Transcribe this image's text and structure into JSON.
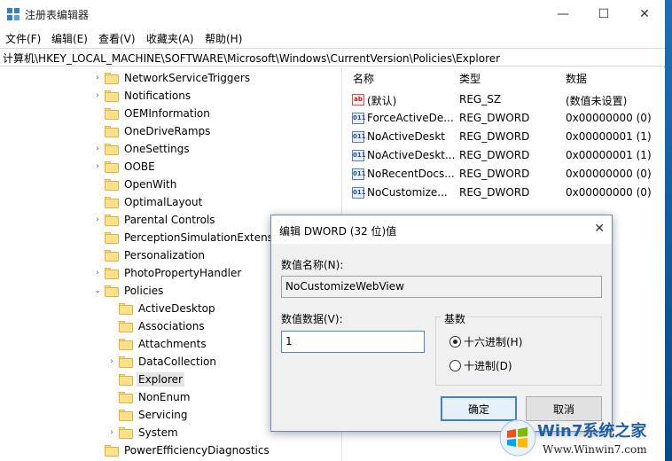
{
  "window": {
    "title": "注册表编辑器",
    "minimize": "—",
    "maximize": "☐",
    "close": "✕"
  },
  "menu": [
    "文件(F)",
    "编辑(E)",
    "查看(V)",
    "收藏夹(A)",
    "帮助(H)"
  ],
  "address": "计算机\\HKEY_LOCAL_MACHINE\\SOFTWARE\\Microsoft\\Windows\\CurrentVersion\\Policies\\Explorer",
  "tree": [
    {
      "label": "NetworkServiceTriggers",
      "arrow": "›"
    },
    {
      "label": "Notifications",
      "arrow": "›"
    },
    {
      "label": "OEMInformation",
      "arrow": ""
    },
    {
      "label": "OneDriveRamps",
      "arrow": ""
    },
    {
      "label": "OneSettings",
      "arrow": "›"
    },
    {
      "label": "OOBE",
      "arrow": "›"
    },
    {
      "label": "OpenWith",
      "arrow": ""
    },
    {
      "label": "OptimalLayout",
      "arrow": ""
    },
    {
      "label": "Parental Controls",
      "arrow": "›"
    },
    {
      "label": "PerceptionSimulationExtensio",
      "arrow": ""
    },
    {
      "label": "Personalization",
      "arrow": ""
    },
    {
      "label": "PhotoPropertyHandler",
      "arrow": "›"
    },
    {
      "label": "Policies",
      "arrow": "⌄"
    },
    {
      "label": "ActiveDesktop",
      "arrow": ""
    },
    {
      "label": "Associations",
      "arrow": ""
    },
    {
      "label": "Attachments",
      "arrow": ""
    },
    {
      "label": "DataCollection",
      "arrow": "›"
    },
    {
      "label": "Explorer",
      "arrow": ""
    },
    {
      "label": "NonEnum",
      "arrow": ""
    },
    {
      "label": "Servicing",
      "arrow": ""
    },
    {
      "label": "System",
      "arrow": "›"
    },
    {
      "label": "PowerEfficiencyDiagnostics",
      "arrow": ""
    }
  ],
  "list": {
    "headers": {
      "name": "名称",
      "type": "类型",
      "data": "数据"
    },
    "rows": [
      {
        "icon": "ab",
        "name": "(默认)",
        "type": "REG_SZ",
        "data": "(数值未设置)"
      },
      {
        "icon": "011",
        "name": "ForceActiveDe...",
        "type": "REG_DWORD",
        "data": "0x00000000 (0)"
      },
      {
        "icon": "011",
        "name": "NoActiveDeskt",
        "type": "REG_DWORD",
        "data": "0x00000001 (1)"
      },
      {
        "icon": "011",
        "name": "NoActiveDeskt...",
        "type": "REG_DWORD",
        "data": "0x00000001 (1)"
      },
      {
        "icon": "011",
        "name": "NoRecentDocs...",
        "type": "REG_DWORD",
        "data": "0x00000000 (0)"
      },
      {
        "icon": "011",
        "name": "NoCustomize...",
        "type": "REG_DWORD",
        "data": "0x00000000 (0)"
      }
    ]
  },
  "dialog": {
    "title": "编辑 DWORD (32 位)值",
    "close": "✕",
    "name_label": "数值名称(N):",
    "name_value": "NoCustomizeWebView",
    "data_label": "数值数据(V):",
    "data_value": "1",
    "base_label": "基数",
    "hex_label": "十六进制(H)",
    "dec_label": "十进制(D)",
    "ok": "确定",
    "cancel": "取消"
  },
  "watermark": {
    "text1": "Win7系统之家",
    "text2": "Www.Winwin7.com"
  },
  "colors": {
    "accent": "#3b82d6",
    "folder": "#ffe08a",
    "selection": "#e5e5e5"
  }
}
